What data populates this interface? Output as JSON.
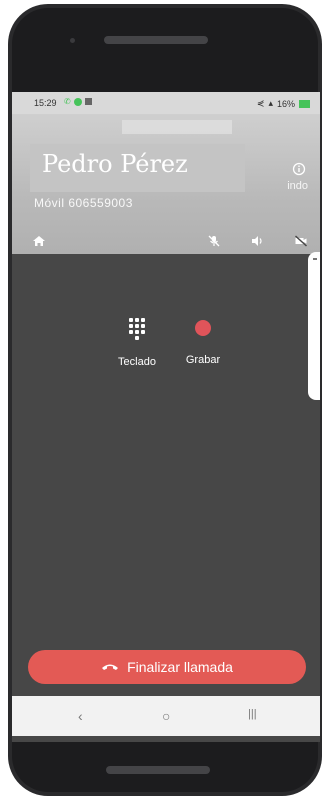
{
  "status_bar": {
    "time": "15:29",
    "battery": "16%"
  },
  "caller": {
    "name": "Pedro Pérez",
    "number": "Móvil 606559003",
    "status": "indo"
  },
  "actions": {
    "keypad_label": "Teclado",
    "record_label": "Grabar"
  },
  "end_call": {
    "label": "Finalizar llamada"
  },
  "nav": {
    "back": "‹",
    "home": "○",
    "recent": "|||"
  },
  "colors": {
    "end_call": "#e35a55",
    "record": "#e0545a",
    "screen_bg": "#474747"
  }
}
